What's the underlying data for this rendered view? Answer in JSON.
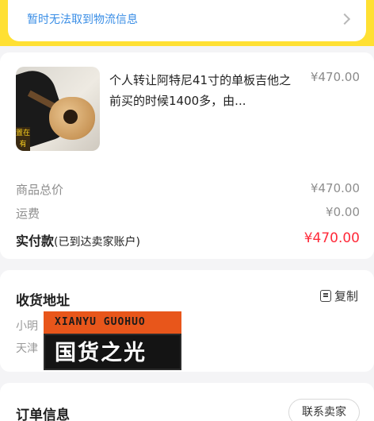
{
  "logistics": {
    "message": "暂时无法取到物流信息"
  },
  "product": {
    "title": "个人转让阿特尼41寸的单板吉他之前买的时候1400多，由...",
    "price": "¥470.00",
    "thumb_tag": "置在有"
  },
  "fees": {
    "goods_total_label": "商品总价",
    "goods_total_value": "¥470.00",
    "shipping_label": "运费",
    "shipping_value": "¥0.00",
    "paid_label": "实付款",
    "paid_sub": "(已到达卖家账户)",
    "paid_value": "¥470.00"
  },
  "address": {
    "title": "收货地址",
    "copy_label": "复制",
    "name": "小明",
    "city": "天津"
  },
  "watermark": {
    "top_text": "XIANYU GUOHUO",
    "bottom_text": "国货之光"
  },
  "order": {
    "title": "订单信息",
    "contact_label": "联系卖家"
  },
  "colors": {
    "brand_yellow": "#ffe033",
    "link_blue": "#3a8ee6",
    "price_red": "#ff2a3a"
  }
}
